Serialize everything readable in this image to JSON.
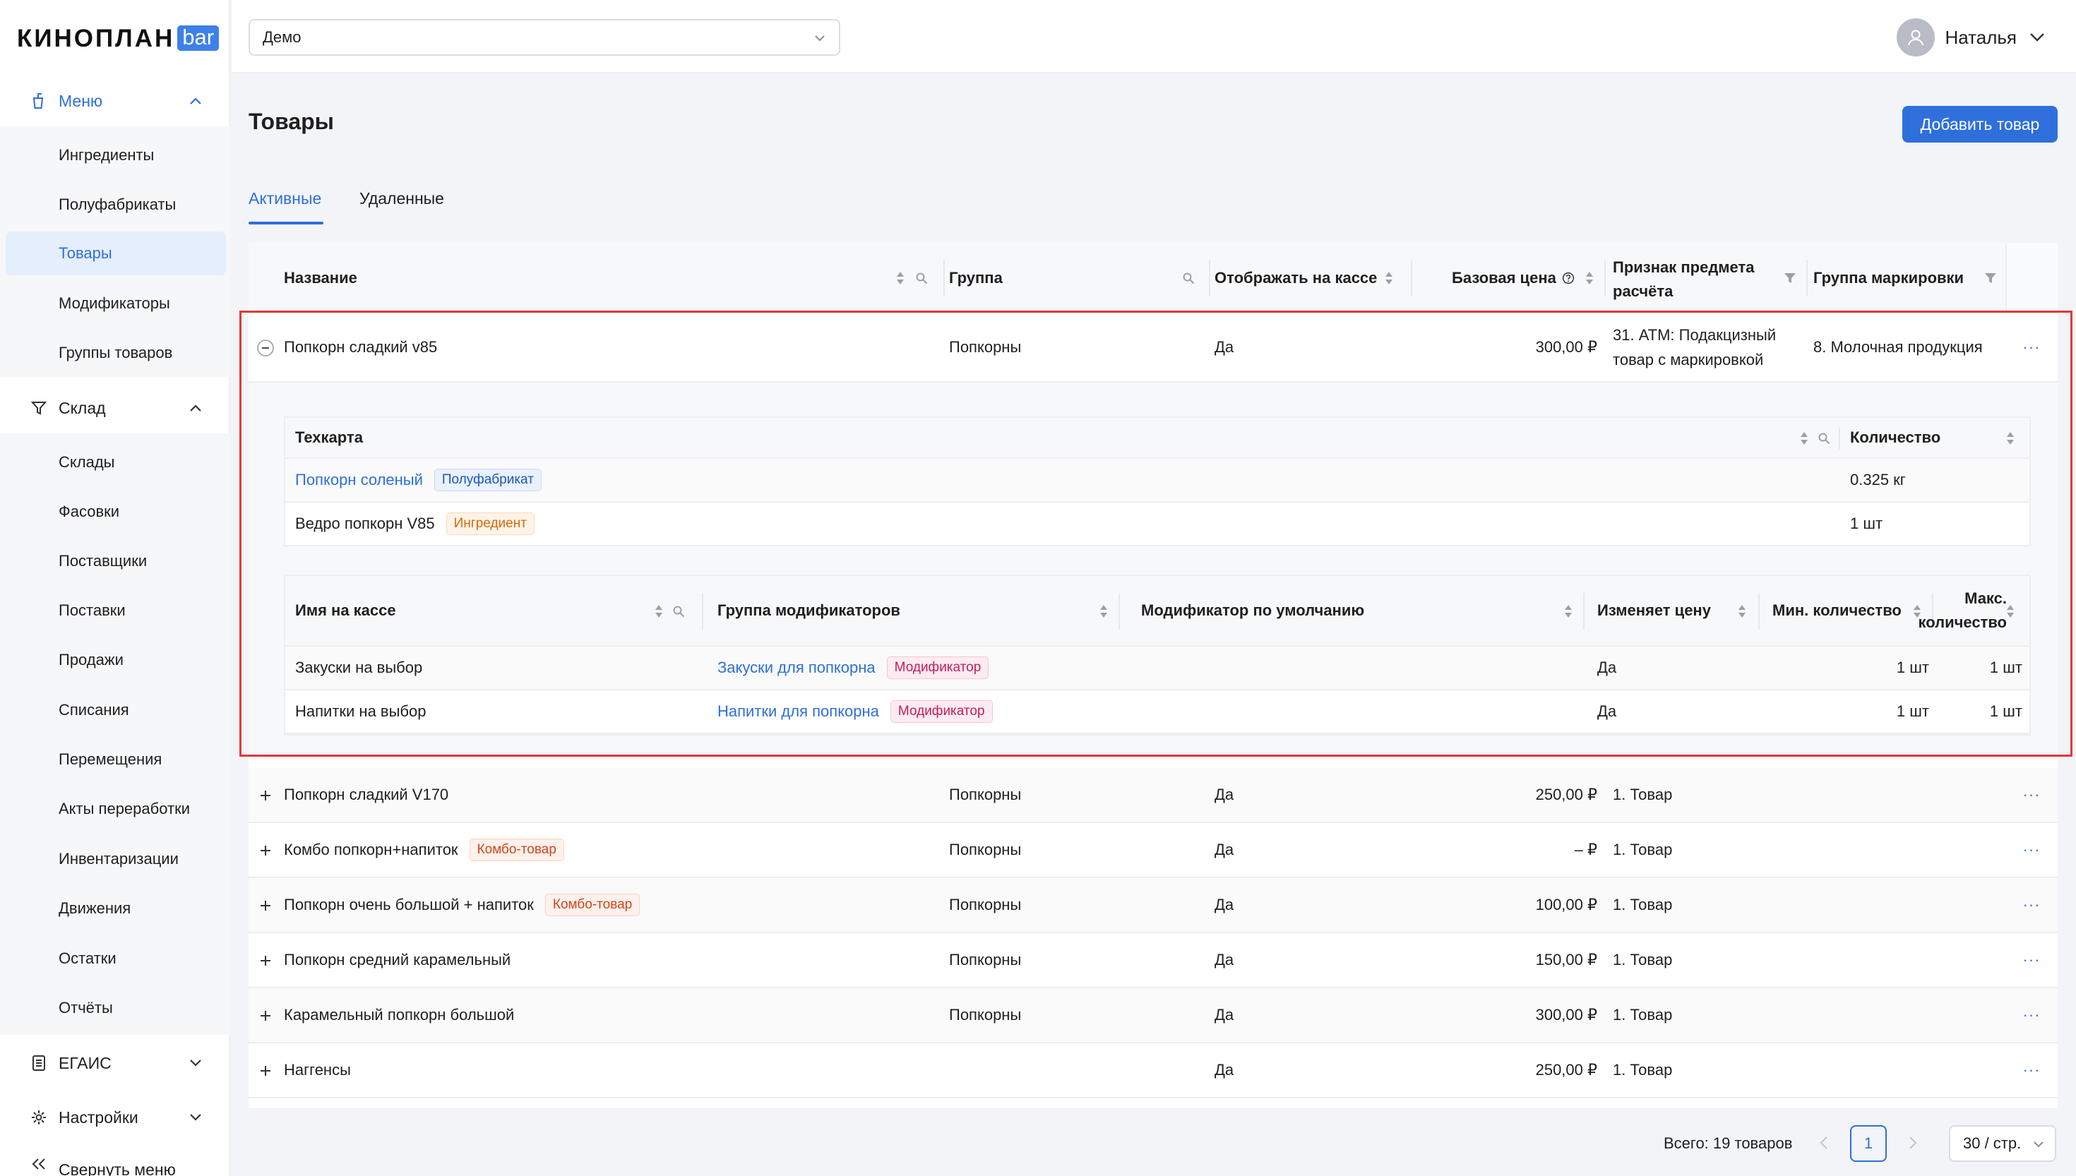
{
  "app": {
    "logo_text": "КИНОПЛАН",
    "logo_badge": "bar",
    "cinema": "Демо",
    "user_name": "Наталья"
  },
  "sidebar": {
    "menu": {
      "label": "Меню",
      "items": [
        "Ингредиенты",
        "Полуфабрикаты",
        "Товары",
        "Модификаторы",
        "Группы товаров"
      ]
    },
    "warehouse": {
      "label": "Склад",
      "items": [
        "Склады",
        "Фасовки",
        "Поставщики",
        "Поставки",
        "Продажи",
        "Списания",
        "Перемещения",
        "Акты переработки",
        "Инвентаризации",
        "Движения",
        "Остатки",
        "Отчёты"
      ]
    },
    "egais": {
      "label": "ЕГАИС"
    },
    "settings": {
      "label": "Настройки"
    },
    "collapse": {
      "label": "Свернуть меню"
    }
  },
  "page": {
    "title": "Товары",
    "add_button": "Добавить товар",
    "tabs": [
      "Активные",
      "Удаленные"
    ]
  },
  "table": {
    "headers": {
      "name": "Название",
      "group": "Группа",
      "show": "Отображать на кассе",
      "price": "Базовая цена",
      "sign_line1": "Признак предмета",
      "sign_line2": "расчёта",
      "marking": "Группа маркировки"
    },
    "expanded_row": {
      "name": "Попкорн сладкий v85",
      "group": "Попкорны",
      "show": "Да",
      "price": "300,00 ₽",
      "sign_line1": "31. АТМ: Подакцизный",
      "sign_line2": "товар с маркировкой",
      "marking": "8. Молочная продукция",
      "techcard": {
        "header_name": "Техкарта",
        "header_qty": "Количество",
        "rows": [
          {
            "name": "Попкорн соленый",
            "tag": "Полуфабрикат",
            "qty": "0.325 кг"
          },
          {
            "name": "Ведро попкорн V85",
            "tag": "Ингредиент",
            "qty": "1 шт"
          }
        ]
      },
      "modifiers": {
        "headers": {
          "pos_name": "Имя на кассе",
          "group": "Группа модификаторов",
          "default": "Модификатор по умолчанию",
          "changes_price": "Изменяет цену",
          "min_qty": "Мин. количество",
          "max_qty_line1": "Макс.",
          "max_qty_line2": "количество"
        },
        "rows": [
          {
            "pos_name": "Закуски на выбор",
            "group": "Закуски для попкорна",
            "tag": "Модификатор",
            "changes_price": "Да",
            "min_qty": "1 шт",
            "max_qty": "1 шт"
          },
          {
            "pos_name": "Напитки на выбор",
            "group": "Напитки для попкорна",
            "tag": "Модификатор",
            "changes_price": "Да",
            "min_qty": "1 шт",
            "max_qty": "1 шт"
          }
        ]
      }
    },
    "rows": [
      {
        "name": "Попкорн сладкий V170",
        "tag": "",
        "group": "Попкорны",
        "show": "Да",
        "price": "250,00 ₽",
        "sign": "1. Товар"
      },
      {
        "name": "Комбо попкорн+напиток",
        "tag": "Комбо-товар",
        "group": "Попкорны",
        "show": "Да",
        "price": "– ₽",
        "sign": "1. Товар"
      },
      {
        "name": "Попкорн очень большой + напиток",
        "tag": "Комбо-товар",
        "group": "Попкорны",
        "show": "Да",
        "price": "100,00 ₽",
        "sign": "1. Товар"
      },
      {
        "name": "Попкорн средний карамельный",
        "tag": "",
        "group": "Попкорны",
        "show": "Да",
        "price": "150,00 ₽",
        "sign": "1. Товар"
      },
      {
        "name": "Карамельный попкорн большой",
        "tag": "",
        "group": "Попкорны",
        "show": "Да",
        "price": "300,00 ₽",
        "sign": "1. Товар"
      },
      {
        "name": "Наггенсы",
        "tag": "",
        "group": "",
        "show": "Да",
        "price": "250,00 ₽",
        "sign": "1. Товар"
      }
    ],
    "row_actions": "···"
  },
  "pagination": {
    "total": "Всего: 19 товаров",
    "current_page": "1",
    "page_size": "30 / стр."
  },
  "colors": {
    "accent": "#2f6fdb",
    "highlight": "#e03a3a",
    "combo_tag": "#d0451b",
    "modifier_tag": "#c41d57"
  }
}
